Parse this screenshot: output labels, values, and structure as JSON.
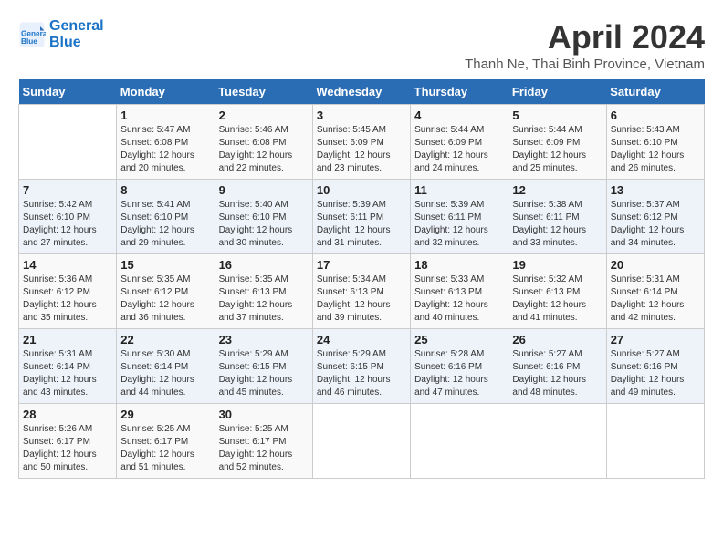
{
  "header": {
    "logo_line1": "General",
    "logo_line2": "Blue",
    "month_year": "April 2024",
    "location": "Thanh Ne, Thai Binh Province, Vietnam"
  },
  "days_of_week": [
    "Sunday",
    "Monday",
    "Tuesday",
    "Wednesday",
    "Thursday",
    "Friday",
    "Saturday"
  ],
  "weeks": [
    [
      {
        "day": "",
        "info": ""
      },
      {
        "day": "1",
        "info": "Sunrise: 5:47 AM\nSunset: 6:08 PM\nDaylight: 12 hours\nand 20 minutes."
      },
      {
        "day": "2",
        "info": "Sunrise: 5:46 AM\nSunset: 6:08 PM\nDaylight: 12 hours\nand 22 minutes."
      },
      {
        "day": "3",
        "info": "Sunrise: 5:45 AM\nSunset: 6:09 PM\nDaylight: 12 hours\nand 23 minutes."
      },
      {
        "day": "4",
        "info": "Sunrise: 5:44 AM\nSunset: 6:09 PM\nDaylight: 12 hours\nand 24 minutes."
      },
      {
        "day": "5",
        "info": "Sunrise: 5:44 AM\nSunset: 6:09 PM\nDaylight: 12 hours\nand 25 minutes."
      },
      {
        "day": "6",
        "info": "Sunrise: 5:43 AM\nSunset: 6:10 PM\nDaylight: 12 hours\nand 26 minutes."
      }
    ],
    [
      {
        "day": "7",
        "info": "Sunrise: 5:42 AM\nSunset: 6:10 PM\nDaylight: 12 hours\nand 27 minutes."
      },
      {
        "day": "8",
        "info": "Sunrise: 5:41 AM\nSunset: 6:10 PM\nDaylight: 12 hours\nand 29 minutes."
      },
      {
        "day": "9",
        "info": "Sunrise: 5:40 AM\nSunset: 6:10 PM\nDaylight: 12 hours\nand 30 minutes."
      },
      {
        "day": "10",
        "info": "Sunrise: 5:39 AM\nSunset: 6:11 PM\nDaylight: 12 hours\nand 31 minutes."
      },
      {
        "day": "11",
        "info": "Sunrise: 5:39 AM\nSunset: 6:11 PM\nDaylight: 12 hours\nand 32 minutes."
      },
      {
        "day": "12",
        "info": "Sunrise: 5:38 AM\nSunset: 6:11 PM\nDaylight: 12 hours\nand 33 minutes."
      },
      {
        "day": "13",
        "info": "Sunrise: 5:37 AM\nSunset: 6:12 PM\nDaylight: 12 hours\nand 34 minutes."
      }
    ],
    [
      {
        "day": "14",
        "info": "Sunrise: 5:36 AM\nSunset: 6:12 PM\nDaylight: 12 hours\nand 35 minutes."
      },
      {
        "day": "15",
        "info": "Sunrise: 5:35 AM\nSunset: 6:12 PM\nDaylight: 12 hours\nand 36 minutes."
      },
      {
        "day": "16",
        "info": "Sunrise: 5:35 AM\nSunset: 6:13 PM\nDaylight: 12 hours\nand 37 minutes."
      },
      {
        "day": "17",
        "info": "Sunrise: 5:34 AM\nSunset: 6:13 PM\nDaylight: 12 hours\nand 39 minutes."
      },
      {
        "day": "18",
        "info": "Sunrise: 5:33 AM\nSunset: 6:13 PM\nDaylight: 12 hours\nand 40 minutes."
      },
      {
        "day": "19",
        "info": "Sunrise: 5:32 AM\nSunset: 6:13 PM\nDaylight: 12 hours\nand 41 minutes."
      },
      {
        "day": "20",
        "info": "Sunrise: 5:31 AM\nSunset: 6:14 PM\nDaylight: 12 hours\nand 42 minutes."
      }
    ],
    [
      {
        "day": "21",
        "info": "Sunrise: 5:31 AM\nSunset: 6:14 PM\nDaylight: 12 hours\nand 43 minutes."
      },
      {
        "day": "22",
        "info": "Sunrise: 5:30 AM\nSunset: 6:14 PM\nDaylight: 12 hours\nand 44 minutes."
      },
      {
        "day": "23",
        "info": "Sunrise: 5:29 AM\nSunset: 6:15 PM\nDaylight: 12 hours\nand 45 minutes."
      },
      {
        "day": "24",
        "info": "Sunrise: 5:29 AM\nSunset: 6:15 PM\nDaylight: 12 hours\nand 46 minutes."
      },
      {
        "day": "25",
        "info": "Sunrise: 5:28 AM\nSunset: 6:16 PM\nDaylight: 12 hours\nand 47 minutes."
      },
      {
        "day": "26",
        "info": "Sunrise: 5:27 AM\nSunset: 6:16 PM\nDaylight: 12 hours\nand 48 minutes."
      },
      {
        "day": "27",
        "info": "Sunrise: 5:27 AM\nSunset: 6:16 PM\nDaylight: 12 hours\nand 49 minutes."
      }
    ],
    [
      {
        "day": "28",
        "info": "Sunrise: 5:26 AM\nSunset: 6:17 PM\nDaylight: 12 hours\nand 50 minutes."
      },
      {
        "day": "29",
        "info": "Sunrise: 5:25 AM\nSunset: 6:17 PM\nDaylight: 12 hours\nand 51 minutes."
      },
      {
        "day": "30",
        "info": "Sunrise: 5:25 AM\nSunset: 6:17 PM\nDaylight: 12 hours\nand 52 minutes."
      },
      {
        "day": "",
        "info": ""
      },
      {
        "day": "",
        "info": ""
      },
      {
        "day": "",
        "info": ""
      },
      {
        "day": "",
        "info": ""
      }
    ]
  ]
}
